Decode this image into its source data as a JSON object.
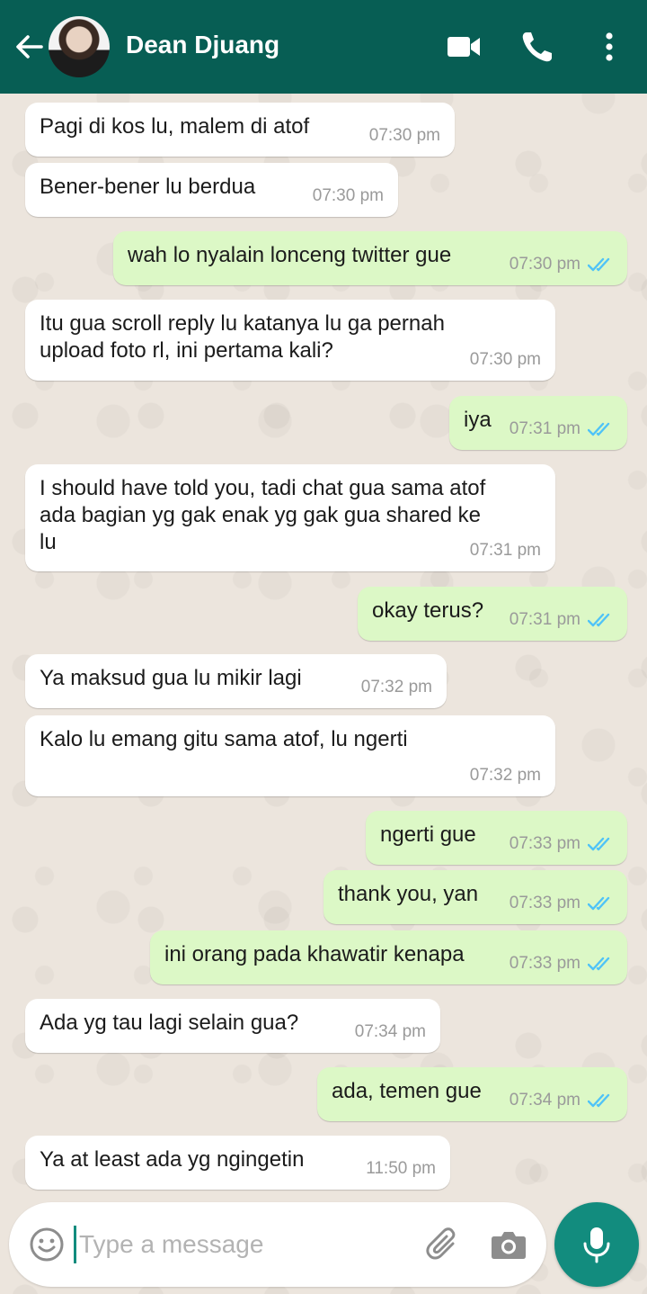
{
  "header": {
    "contact_name": "Dean Djuang"
  },
  "messages": [
    {
      "dir": "in",
      "text": "Pagi di kos lu, malem di atof",
      "time": "07:30 pm"
    },
    {
      "dir": "in",
      "text": "Bener-bener lu berdua",
      "time": "07:30 pm"
    },
    {
      "dir": "out",
      "text": "wah lo nyalain lonceng twitter gue",
      "time": "07:30 pm",
      "status": "read"
    },
    {
      "dir": "in",
      "text": "Itu gua scroll reply lu katanya lu ga pernah\nupload foto rl, ini pertama kali?",
      "time": "07:30 pm"
    },
    {
      "dir": "out",
      "text": "iya",
      "time": "07:31 pm",
      "status": "read"
    },
    {
      "dir": "in",
      "text": "I should have told you, tadi chat gua sama atof\nada bagian yg gak enak yg gak gua shared ke\nlu",
      "time": "07:31 pm"
    },
    {
      "dir": "out",
      "text": "okay terus?",
      "time": "07:31 pm",
      "status": "read"
    },
    {
      "dir": "in",
      "text": "Ya maksud gua lu mikir lagi",
      "time": "07:32 pm"
    },
    {
      "dir": "in",
      "text": "Kalo lu emang gitu sama atof, lu ngerti",
      "time": "07:32 pm"
    },
    {
      "dir": "out",
      "text": "ngerti gue",
      "time": "07:33 pm",
      "status": "read"
    },
    {
      "dir": "out",
      "text": "thank you, yan",
      "time": "07:33 pm",
      "status": "read"
    },
    {
      "dir": "out",
      "text": "ini orang pada khawatir kenapa",
      "time": "07:33 pm",
      "status": "read"
    },
    {
      "dir": "in",
      "text": "Ada yg tau lagi selain gua?",
      "time": "07:34 pm"
    },
    {
      "dir": "out",
      "text": "ada, temen gue",
      "time": "07:34 pm",
      "status": "read"
    },
    {
      "dir": "in",
      "text": "Ya at least ada yg ngingetin",
      "time": "11:50 pm"
    }
  ],
  "composer": {
    "placeholder": "Type a message"
  },
  "colors": {
    "header": "#075e54",
    "outgoing_bubble": "#dcf8c6",
    "incoming_bubble": "#ffffff",
    "read_ticks": "#4fc3f7",
    "mic_button": "#128c7e",
    "wallpaper": "#ece5dd"
  },
  "icons": [
    "back-arrow-icon",
    "video-call-icon",
    "phone-icon",
    "more-vert-icon",
    "emoji-icon",
    "attach-icon",
    "camera-icon",
    "mic-icon",
    "double-check-icon"
  ]
}
